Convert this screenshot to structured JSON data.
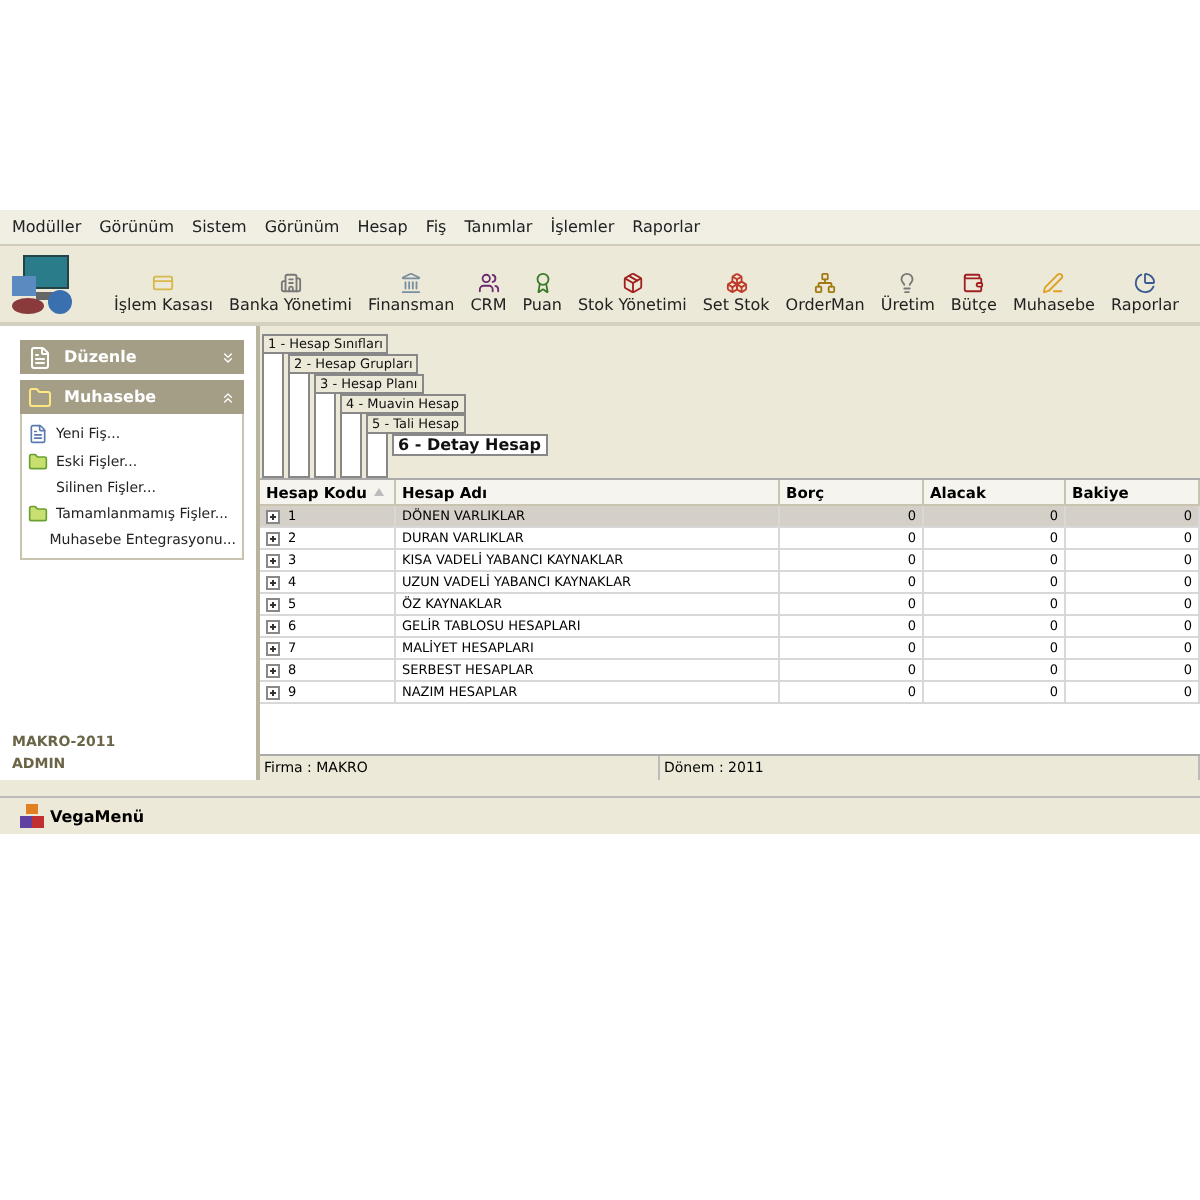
{
  "menu": [
    "Modüller",
    "Görünüm",
    "Sistem",
    "Görünüm",
    "Hesap",
    "Fiş",
    "Tanımlar",
    "İşlemler",
    "Raporlar"
  ],
  "toolbar": [
    "İşlem Kasası",
    "Banka Yönetimi",
    "Finansman",
    "CRM",
    "Puan",
    "Stok Yönetimi",
    "Set Stok",
    "OrderMan",
    "Üretim",
    "Bütçe",
    "Muhasebe",
    "Raporlar"
  ],
  "sidebar": {
    "groups": [
      {
        "title": "Düzenle",
        "expanded": false
      },
      {
        "title": "Muhasebe",
        "expanded": true,
        "items": [
          {
            "label": "Yeni Fiş...",
            "kind": "document"
          },
          {
            "label": "Eski Fişler...",
            "kind": "folder"
          },
          {
            "label": "Silinen Fişler...",
            "kind": "plain"
          },
          {
            "label": "Tamamlanmamış Fişler...",
            "kind": "folder"
          },
          {
            "label": "Muhasebe Entegrasyonu...",
            "kind": "plain"
          }
        ]
      }
    ],
    "footer": [
      "MAKRO-2011",
      "ADMIN"
    ]
  },
  "levels": [
    {
      "label": "1 - Hesap Sınıfları",
      "selected": false
    },
    {
      "label": "2 - Hesap Grupları",
      "selected": false
    },
    {
      "label": "3 - Hesap  Planı",
      "selected": false
    },
    {
      "label": "4 - Muavin Hesap",
      "selected": false
    },
    {
      "label": "5 - Tali Hesap",
      "selected": false
    },
    {
      "label": "6 - Detay Hesap",
      "selected": true
    }
  ],
  "table": {
    "columns": [
      "Hesap Kodu",
      "Hesap Adı",
      "Borç",
      "Alacak",
      "Bakiye"
    ],
    "rows": [
      {
        "cells": [
          "1",
          "DÖNEN VARLIKLAR",
          "0",
          "0",
          "0"
        ],
        "selected": true
      },
      {
        "cells": [
          "2",
          "DURAN VARLIKLAR",
          "0",
          "0",
          "0"
        ],
        "selected": false
      },
      {
        "cells": [
          "3",
          "KISA VADELİ YABANCI KAYNAKLAR",
          "0",
          "0",
          "0"
        ],
        "selected": false
      },
      {
        "cells": [
          "4",
          "UZUN VADELİ YABANCI KAYNAKLAR",
          "0",
          "0",
          "0"
        ],
        "selected": false
      },
      {
        "cells": [
          "5",
          "ÖZ KAYNAKLAR",
          "0",
          "0",
          "0"
        ],
        "selected": false
      },
      {
        "cells": [
          "6",
          "GELİR TABLOSU HESAPLARI",
          "0",
          "0",
          "0"
        ],
        "selected": false
      },
      {
        "cells": [
          "7",
          "MALİYET HESAPLARI",
          "0",
          "0",
          "0"
        ],
        "selected": false
      },
      {
        "cells": [
          "8",
          "SERBEST HESAPLAR",
          "0",
          "0",
          "0"
        ],
        "selected": false
      },
      {
        "cells": [
          "9",
          "NAZIM HESAPLAR",
          "0",
          "0",
          "0"
        ],
        "selected": false
      }
    ]
  },
  "status_bar": [
    "Firma : MAKRO",
    "Dönem : 2011"
  ],
  "taskbar": {
    "label": "VegaMenü"
  }
}
